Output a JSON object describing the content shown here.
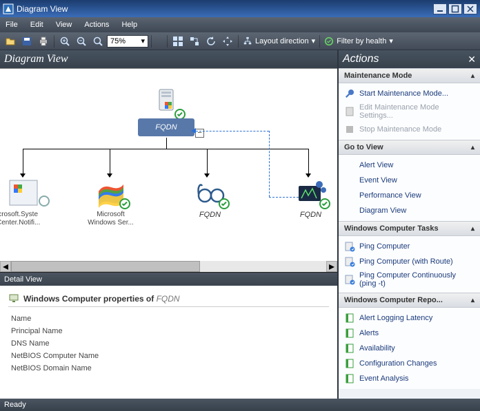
{
  "title": "Diagram View",
  "menu": {
    "file": "File",
    "edit": "Edit",
    "view": "View",
    "actions": "Actions",
    "help": "Help"
  },
  "toolbar": {
    "zoom": "75%",
    "layout_label": "Layout direction",
    "filter_label": "Filter by health"
  },
  "view_header": "Diagram View",
  "diagram": {
    "root_label": "FQDN",
    "children": [
      {
        "label_line1": "icrosoft.Syste",
        "label_line2": "Center.Notifi..."
      },
      {
        "label_line1": "Microsoft",
        "label_line2": "Windows Ser..."
      },
      {
        "label_center": "FQDN"
      },
      {
        "label_center": "FQDN"
      }
    ]
  },
  "detail": {
    "pane_title": "Detail View",
    "heading_prefix": "Windows Computer properties of",
    "heading_target": "FQDN",
    "properties": [
      "Name",
      "Principal Name",
      "DNS Name",
      "NetBIOS Computer Name",
      "NetBIOS Domain Name"
    ]
  },
  "actions": {
    "title": "Actions",
    "sections": [
      {
        "title": "Maintenance Mode",
        "items": [
          {
            "label": "Start Maintenance Mode...",
            "icon": "wrench",
            "disabled": false
          },
          {
            "label": "Edit Maintenance Mode Settings...",
            "icon": "document",
            "disabled": true
          },
          {
            "label": "Stop Maintenance Mode",
            "icon": "stop",
            "disabled": true
          }
        ]
      },
      {
        "title": "Go to View",
        "items": [
          {
            "label": "Alert View"
          },
          {
            "label": "Event View"
          },
          {
            "label": "Performance View"
          },
          {
            "label": "Diagram View"
          }
        ]
      },
      {
        "title": "Windows Computer Tasks",
        "items": [
          {
            "label": "Ping Computer",
            "icon": "task"
          },
          {
            "label": "Ping Computer (with Route)",
            "icon": "task"
          },
          {
            "label": "Ping Computer Continuously (ping -t)",
            "icon": "task"
          }
        ]
      },
      {
        "title": "Windows Computer Repo...",
        "items": [
          {
            "label": "Alert Logging Latency",
            "icon": "report"
          },
          {
            "label": "Alerts",
            "icon": "report"
          },
          {
            "label": "Availability",
            "icon": "report"
          },
          {
            "label": "Configuration Changes",
            "icon": "report"
          },
          {
            "label": "Event Analysis",
            "icon": "report"
          }
        ]
      }
    ]
  },
  "status": "Ready"
}
